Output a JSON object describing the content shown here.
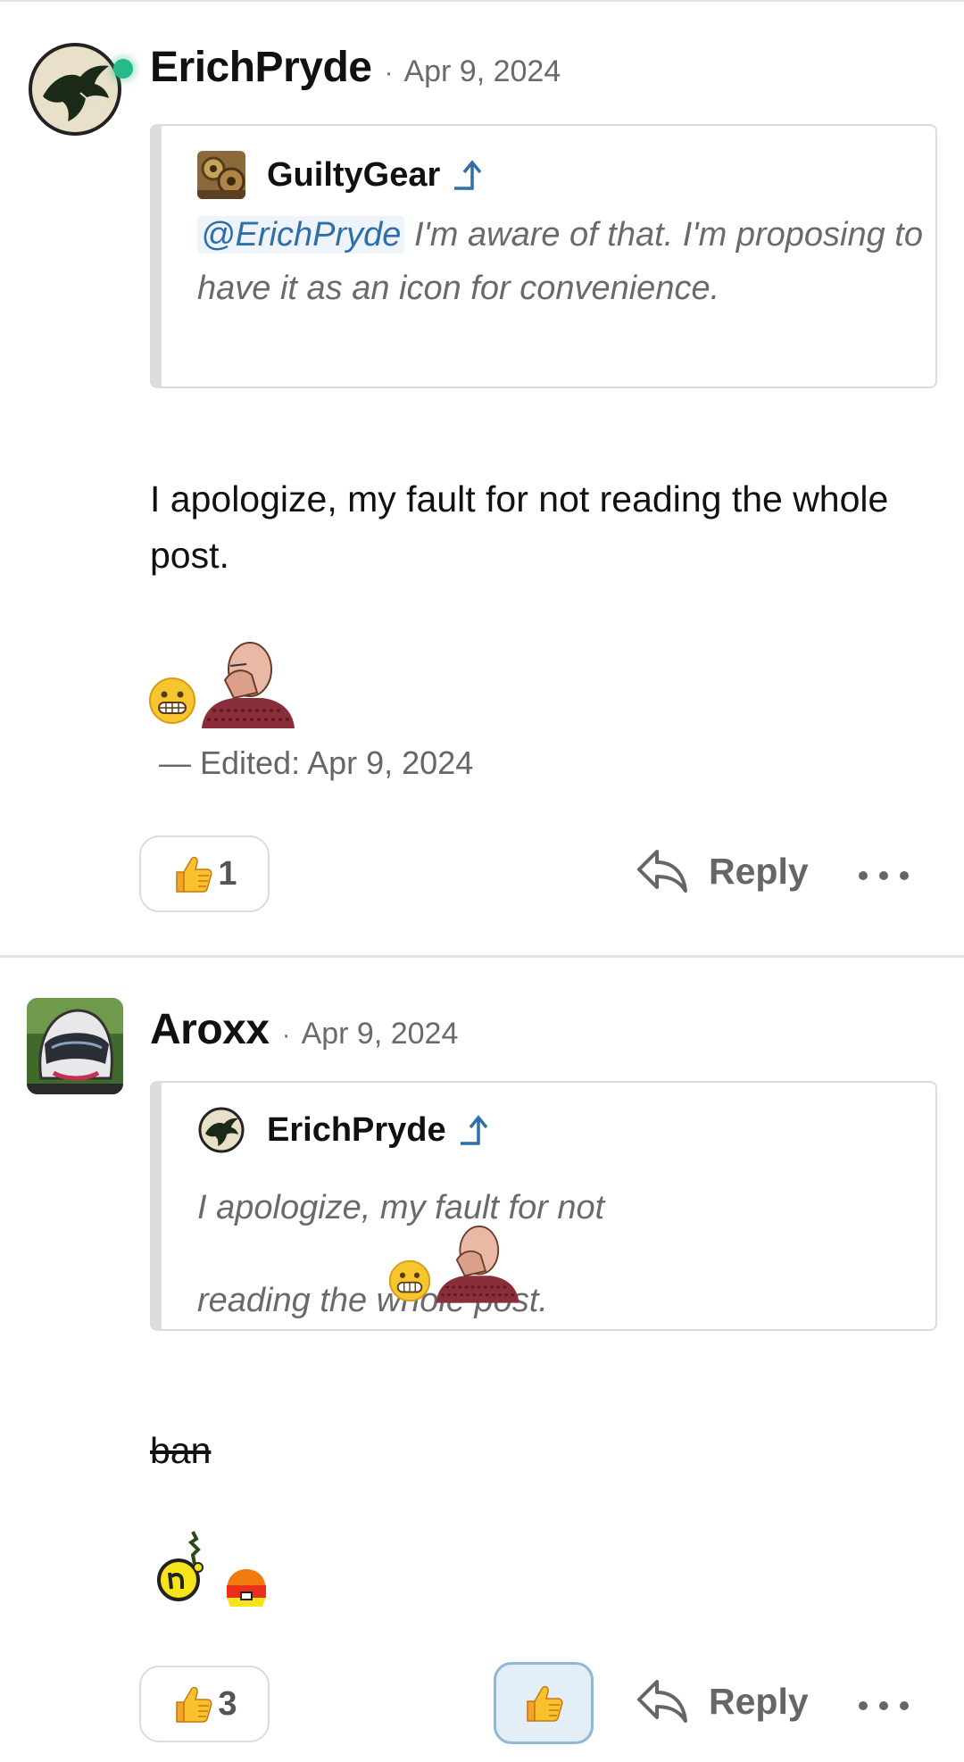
{
  "posts": [
    {
      "username": "ErichPryde",
      "separator": "·",
      "date": "Apr 9, 2024",
      "online": true,
      "avatar_icon": "bird-silhouette-avatar",
      "quote": {
        "username": "GuiltyGear",
        "avatar_icon": "gear-art-avatar",
        "mention": "@ErichPryde",
        "text": " I'm aware of that. I'm proposing to have it as an icon for convenience."
      },
      "body": "I apologize, my fault for not reading the whole post.",
      "emojis": [
        "grimacing-emoji",
        "facepalm-picard-emoji"
      ],
      "edited": "— Edited: Apr 9, 2024",
      "likes": "1",
      "reply_label": "Reply"
    },
    {
      "username": "Aroxx",
      "separator": "·",
      "date": "Apr 9, 2024",
      "online": false,
      "avatar_icon": "motorcycle-helmet-avatar",
      "quote": {
        "username": "ErichPryde",
        "avatar_icon": "bird-silhouette-avatar",
        "text": "I apologize, my fault for not reading the whole post."
      },
      "body": "ban",
      "body_strikethrough": true,
      "emojis": [
        "ban-hammer-emoji",
        "angry-face-emoji"
      ],
      "likes": "3",
      "user_liked": true,
      "reply_label": "Reply"
    }
  ],
  "colors": {
    "mention": "#2f6fa8",
    "online": "#28b98a",
    "quote_border": "#dcdcdc",
    "liked_bg": "#e4eef6"
  }
}
